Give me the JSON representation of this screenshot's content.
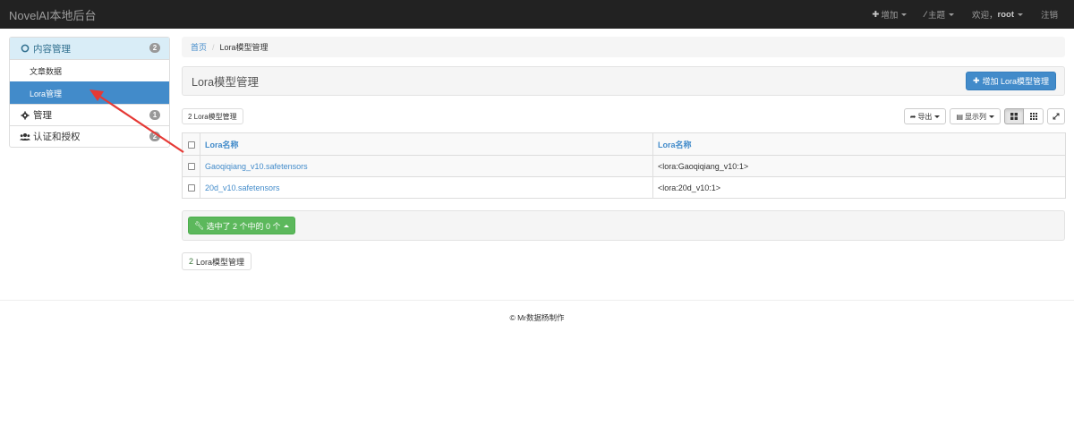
{
  "navbar": {
    "brand": "NovelAI本地后台",
    "add_label": "增加",
    "theme_label": "主题",
    "welcome_prefix": "欢迎，",
    "username": "root",
    "logout_label": "注销"
  },
  "sidebar": {
    "groups": [
      {
        "label": "内容管理",
        "badge": "2",
        "icon": "circle-icon"
      },
      {
        "label": "管理",
        "badge": "1",
        "icon": "gear-icon"
      },
      {
        "label": "认证和授权",
        "badge": "2",
        "icon": "users-icon"
      }
    ],
    "items": [
      {
        "label": "文章数据"
      },
      {
        "label": "Lora管理"
      }
    ]
  },
  "breadcrumb": {
    "home": "首页",
    "current": "Lora模型管理"
  },
  "page": {
    "title": "Lora模型管理",
    "add_button": "增加 Lora模型管理",
    "count_chip": "2 Lora模型管理",
    "count_bottom_num": "2",
    "count_bottom_label": "Lora模型管理"
  },
  "toolbar": {
    "export_label": "导出",
    "columns_label": "显示列"
  },
  "table": {
    "headers": [
      "Lora名称",
      "Lora名称"
    ],
    "rows": [
      {
        "name": "Gaoqiqiang_v10.safetensors",
        "tag": "<lora:Gaoqiqiang_v10:1>"
      },
      {
        "name": "20d_v10.safetensors",
        "tag": "<lora:20d_v10:1>"
      }
    ]
  },
  "actions": {
    "selected_label": "选中了 2 个中的 0 个"
  },
  "footer": {
    "text": "© Mr数据杨制作"
  },
  "colors": {
    "navbar_bg": "#222222",
    "primary": "#428bca",
    "success": "#5cb85c",
    "annotation_arrow": "#e53935"
  }
}
